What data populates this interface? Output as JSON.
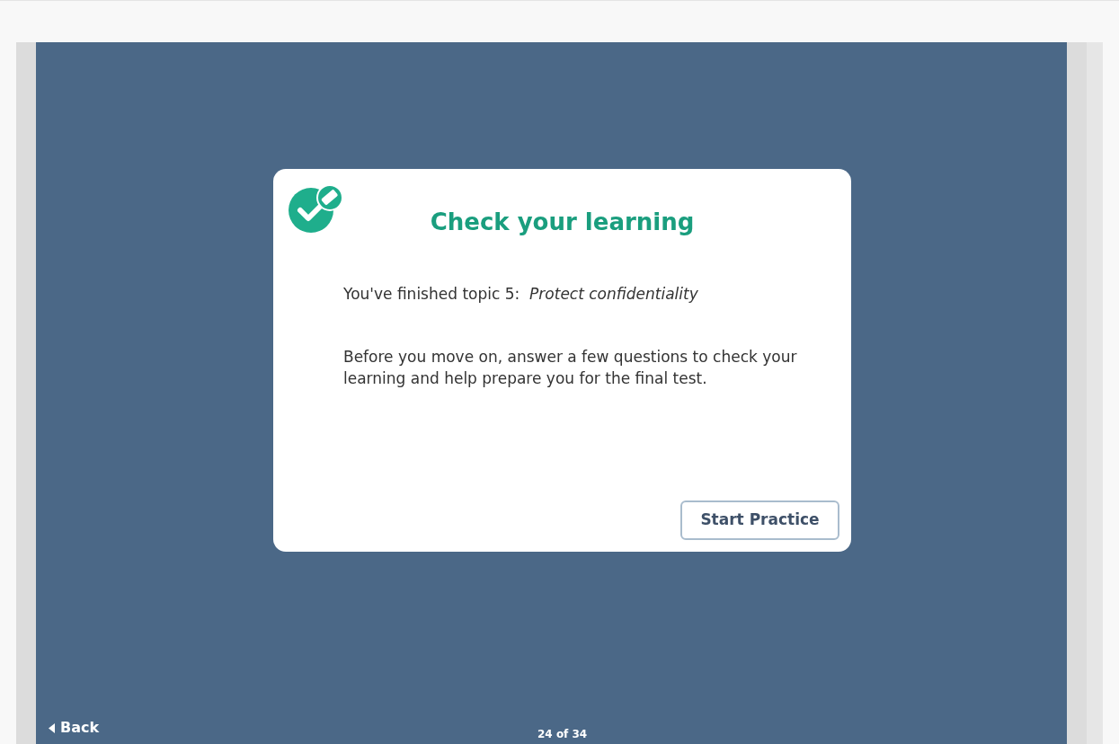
{
  "card": {
    "title": "Check your learning",
    "paragraphs": [
      "You've finished topic 5:  *Protect confidentiality*",
      "Before you move on, answer a few questions to check your learning and help prepare you for the final test."
    ],
    "button": "Start Practice"
  },
  "footer": {
    "back": "Back",
    "page": "24 of 34"
  }
}
